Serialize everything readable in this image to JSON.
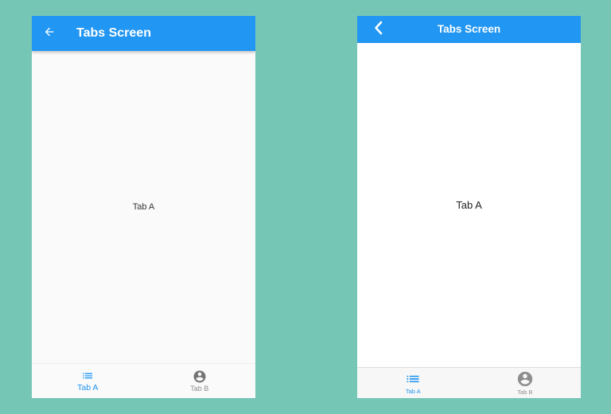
{
  "colors": {
    "background": "#76C6B6",
    "appbar": "#2196F3",
    "active_tab": "#2196F3",
    "inactive_tab": "#757575"
  },
  "android": {
    "appbar": {
      "title": "Tabs Screen",
      "back_icon": "arrow-left-icon"
    },
    "content": {
      "text": "Tab A"
    },
    "tabs": [
      {
        "label": "Tab A",
        "icon": "list-icon",
        "active": true
      },
      {
        "label": "Tab B",
        "icon": "account-circle-icon",
        "active": false
      }
    ]
  },
  "ios": {
    "appbar": {
      "title": "Tabs Screen",
      "back_icon": "chevron-left-icon"
    },
    "content": {
      "text": "Tab A"
    },
    "tabs": [
      {
        "label": "Tab A",
        "icon": "list-icon",
        "active": true
      },
      {
        "label": "Tab B",
        "icon": "account-circle-icon",
        "active": false
      }
    ]
  }
}
